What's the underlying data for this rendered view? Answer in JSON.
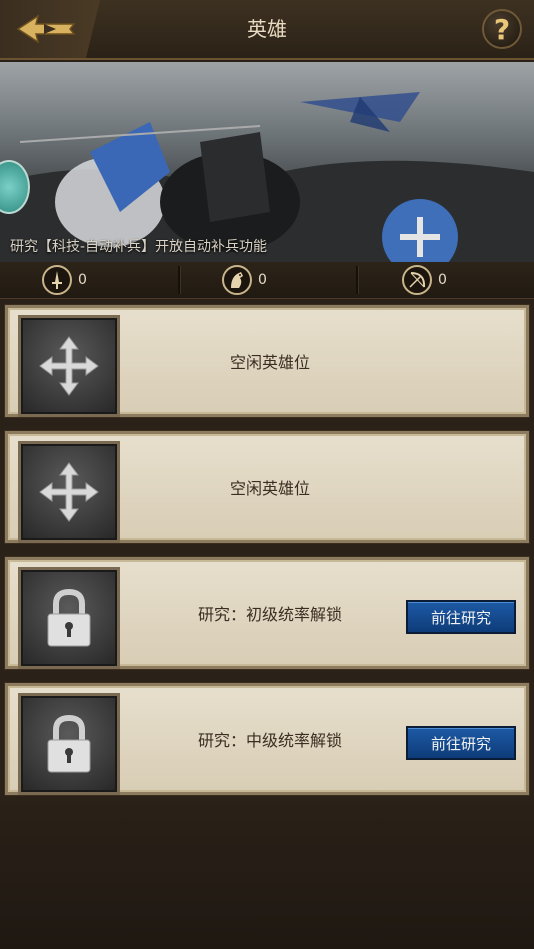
{
  "header": {
    "title": "英雄",
    "back_icon": "back-arrow-icon",
    "help_label": "?"
  },
  "banner": {
    "notice": "研究【科技-自动补兵】开放自动补兵功能"
  },
  "stats": [
    {
      "icon": "sword-icon",
      "value": "0"
    },
    {
      "icon": "horse-icon",
      "value": "0"
    },
    {
      "icon": "bow-icon",
      "value": "0"
    }
  ],
  "slots": [
    {
      "state": "empty",
      "icon": "move-arrows-icon",
      "label": "空闲英雄位"
    },
    {
      "state": "empty",
      "icon": "move-arrows-icon",
      "label": "空闲英雄位"
    },
    {
      "state": "locked",
      "icon": "lock-icon",
      "label": "研究：初级统率解锁",
      "button": "前往研究"
    },
    {
      "state": "locked",
      "icon": "lock-icon",
      "label": "研究：中级统率解锁",
      "button": "前往研究"
    }
  ],
  "colors": {
    "button_blue": "#1d5aa5",
    "card_bg": "#e7dfcd",
    "title_text": "#e9dcc2"
  }
}
